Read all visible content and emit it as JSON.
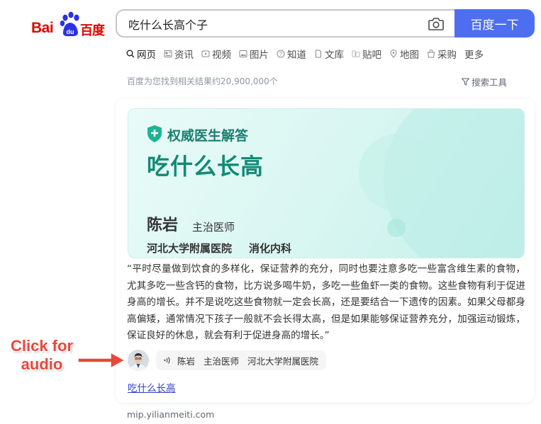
{
  "logo": {
    "latin": "Bai",
    "paw_text": "du",
    "chinese": "百度"
  },
  "search": {
    "value": "吃什么长高个子",
    "button": "百度一下"
  },
  "tabs": [
    {
      "label": "网页",
      "icon": "search-icon",
      "active": true
    },
    {
      "label": "资讯",
      "icon": "news-icon"
    },
    {
      "label": "视频",
      "icon": "video-icon"
    },
    {
      "label": "图片",
      "icon": "image-icon"
    },
    {
      "label": "知道",
      "icon": "question-icon"
    },
    {
      "label": "文库",
      "icon": "document-icon"
    },
    {
      "label": "贴吧",
      "icon": "tieba-icon"
    },
    {
      "label": "地图",
      "icon": "map-icon"
    },
    {
      "label": "采购",
      "icon": "shop-icon"
    },
    {
      "label": "更多"
    }
  ],
  "result_count": "百度为您找到相关结果约20,900,000个",
  "tools_label": "搜索工具",
  "card": {
    "authority_label": "权威医生解答",
    "topic": "吃什么长高",
    "doctor_name": "陈岩",
    "doctor_title": "主治医师",
    "hospital": "河北大学附属医院",
    "department": "消化内科",
    "quote": "“平时尽量做到饮食的多样化，保证营养的充分，同时也要注意多吃一些富含维生素的食物，尤其多吃一些含钙的食物，比方说多喝牛奶，多吃一些鱼虾一类的食物。这些食物有利于促进身高的增长。并不是说吃这些食物就一定会长高，还是要结合一下遗传的因素。如果父母都身高偏矮，通常情况下孩子一般就不会长得太高，但是如果能够保证营养充分，加强运动锻炼，保证良好的休息，就会有利于促进身高的增长。”",
    "audio": {
      "name": "陈岩",
      "title": "主治医师",
      "hospital": "河北大学附属医院"
    },
    "link": "吃什么长高"
  },
  "source_url": "mip.yilianmeiti.com",
  "annotation": {
    "text": "Click for audio",
    "color": "#e8473b"
  },
  "colors": {
    "brand_red": "#e10601",
    "search_blue": "#4e6ef2",
    "teal": "#128a75",
    "link": "#3341c6"
  }
}
